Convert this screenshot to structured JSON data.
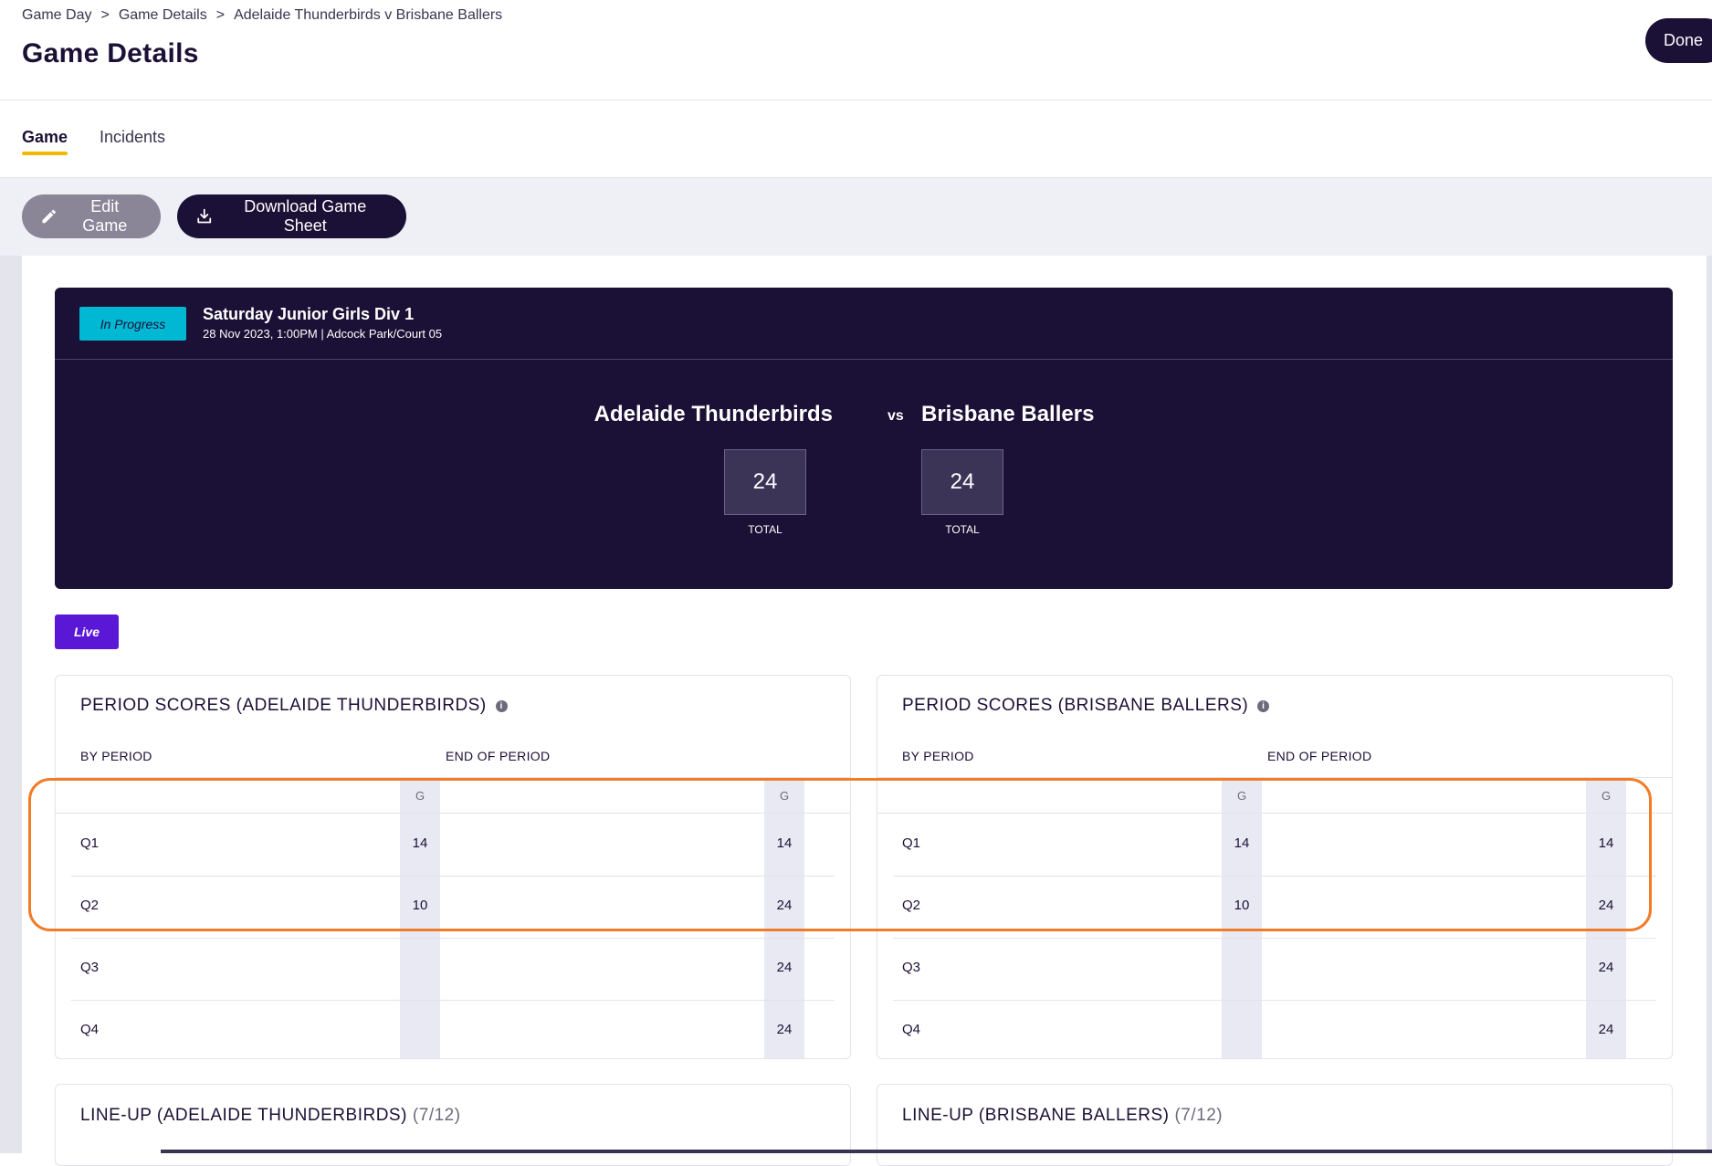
{
  "header": {
    "breadcrumb": [
      "Game Day",
      "Game Details",
      "Adelaide Thunderbirds v Brisbane Ballers"
    ],
    "breadcrumb_sep": ">",
    "title": "Game Details",
    "done_label": "Done"
  },
  "tabs": [
    {
      "label": "Game",
      "active": true
    },
    {
      "label": "Incidents",
      "active": false
    }
  ],
  "toolbar": {
    "edit_label": "Edit Game",
    "download_label": "Download Game Sheet"
  },
  "game": {
    "status": "In Progress",
    "competition": "Saturday Junior Girls Div 1",
    "meta": "28 Nov 2023, 1:00PM | Adcock Park/Court 05",
    "home_team": "Adelaide Thunderbirds",
    "away_team": "Brisbane Ballers",
    "vs": "vs",
    "home_score": "24",
    "away_score": "24",
    "total_label": "TOTAL"
  },
  "live_label": "Live",
  "period_panels": [
    {
      "title": "PERIOD SCORES (ADELAIDE THUNDERBIRDS)",
      "by_period_label": "BY PERIOD",
      "end_of_period_label": "END OF PERIOD",
      "col_head": "G",
      "rows": [
        {
          "period": "Q1",
          "by": "14",
          "end": "14"
        },
        {
          "period": "Q2",
          "by": "10",
          "end": "24"
        },
        {
          "period": "Q3",
          "by": "",
          "end": "24"
        },
        {
          "period": "Q4",
          "by": "",
          "end": "24"
        }
      ]
    },
    {
      "title": "PERIOD SCORES (BRISBANE BALLERS)",
      "by_period_label": "BY PERIOD",
      "end_of_period_label": "END OF PERIOD",
      "col_head": "G",
      "rows": [
        {
          "period": "Q1",
          "by": "14",
          "end": "14"
        },
        {
          "period": "Q2",
          "by": "10",
          "end": "24"
        },
        {
          "period": "Q3",
          "by": "",
          "end": "24"
        },
        {
          "period": "Q4",
          "by": "",
          "end": "24"
        }
      ]
    }
  ],
  "lineups": [
    {
      "title": "LINE-UP (ADELAIDE THUNDERBIRDS)",
      "count": "(7/12)"
    },
    {
      "title": "LINE-UP (BRISBANE BALLERS)",
      "count": "(7/12)"
    }
  ],
  "colors": {
    "primary": "#1b1035",
    "accent_tab": "#f5b800",
    "status_badge": "#00b8d4",
    "live_badge": "#5a17d6",
    "highlight": "#f07c28"
  }
}
